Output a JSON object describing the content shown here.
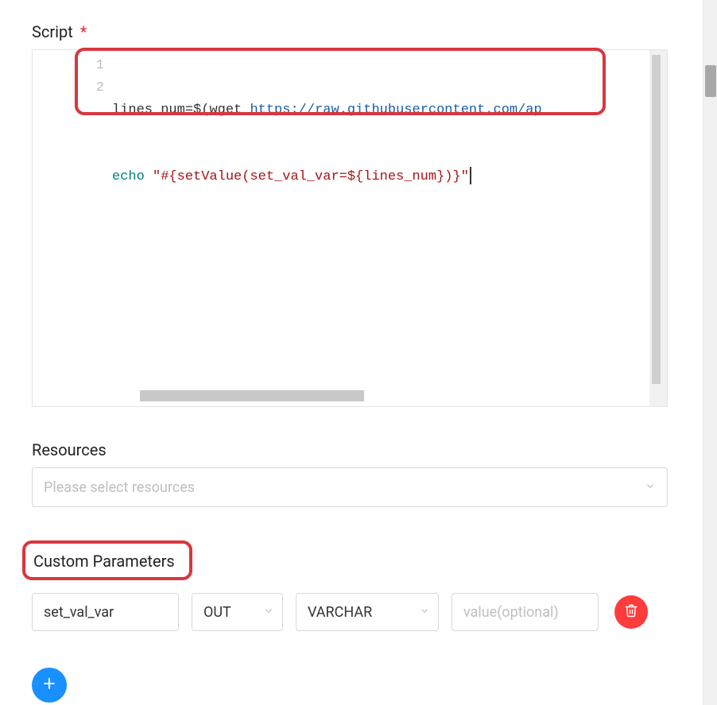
{
  "scriptSection": {
    "label": "Script",
    "required": "*",
    "lineNumbers": [
      1,
      2
    ],
    "code": {
      "line1": {
        "lhs": "lines_num",
        "op": "=$(",
        "cmd": "wget ",
        "url": "https://raw.githubusercontent.com/ap"
      },
      "line2": {
        "echo": "echo",
        "quoteOpen": " \"",
        "template": "#{setValue(set_val_var=${lines_num})}",
        "quoteClose": "\""
      }
    }
  },
  "resourcesSection": {
    "label": "Resources",
    "placeholder": "Please select resources"
  },
  "customParamsSection": {
    "label": "Custom Parameters",
    "row": {
      "name": "set_val_var",
      "direction": "OUT",
      "dataType": "VARCHAR",
      "valuePlaceholder": "value(optional)"
    }
  }
}
